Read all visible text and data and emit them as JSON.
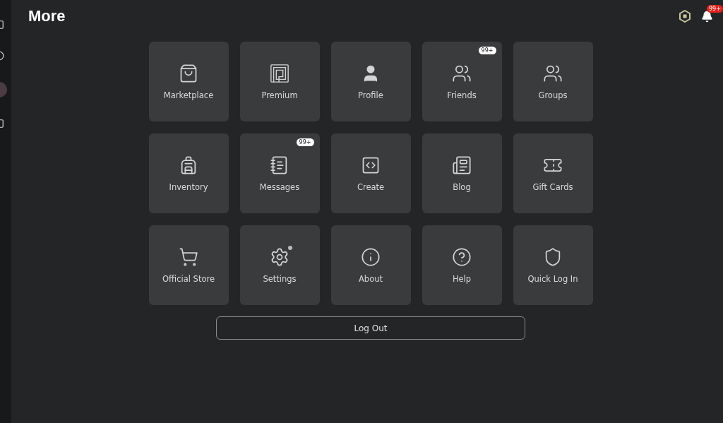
{
  "header": {
    "title": "More",
    "notifications_badge": "99+"
  },
  "tiles": [
    {
      "label": "Marketplace",
      "kind": "bag",
      "dot": false
    },
    {
      "label": "Premium",
      "kind": "premium",
      "dot": false
    },
    {
      "label": "Profile",
      "kind": "person",
      "dot": false
    },
    {
      "label": "Friends",
      "kind": "people",
      "badge": "99+",
      "dot": false
    },
    {
      "label": "Groups",
      "kind": "group",
      "dot": false
    },
    {
      "label": "Inventory",
      "kind": "backpack",
      "dot": false
    },
    {
      "label": "Messages",
      "kind": "message",
      "badge": "99+",
      "dot": false
    },
    {
      "label": "Create",
      "kind": "code",
      "dot": false
    },
    {
      "label": "Blog",
      "kind": "blog",
      "dot": false
    },
    {
      "label": "Gift Cards",
      "kind": "giftcard",
      "dot": false
    },
    {
      "label": "Official Store",
      "kind": "cart",
      "dot": false
    },
    {
      "label": "Settings",
      "kind": "gear",
      "dot": true
    },
    {
      "label": "About",
      "kind": "info",
      "dot": false
    },
    {
      "label": "Help",
      "kind": "help",
      "dot": false
    },
    {
      "label": "Quick Log In",
      "kind": "shield",
      "dot": false
    }
  ],
  "logout": {
    "label": "Log Out"
  }
}
